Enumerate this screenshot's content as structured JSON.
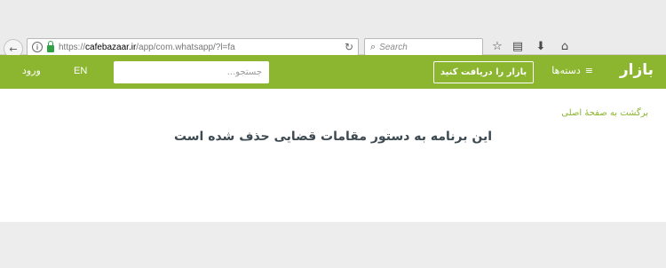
{
  "browser": {
    "url_host": "cafebazaar.ir",
    "url_prefix": "https://",
    "url_path": "/app/com.whatsapp/?l=fa",
    "search_placeholder": "Search",
    "icons": [
      "back-icon",
      "info-icon",
      "lock-icon",
      "reload-icon",
      "search-icon",
      "bookmark-star-icon",
      "clipboard-icon",
      "download-icon",
      "home-icon"
    ]
  },
  "header": {
    "logo": "بازار",
    "categories_label": "دسته‌ها",
    "get_app_label": "بازار را دریافت کنید",
    "search_placeholder": "جستجو...",
    "lang_label": "EN",
    "login_label": "ورود",
    "accent_color": "#8cb630"
  },
  "content": {
    "back_home": "برگشت به صفحهٔ اصلی",
    "message": "این برنامه به دستور مقامات قضایی حذف شده است"
  }
}
